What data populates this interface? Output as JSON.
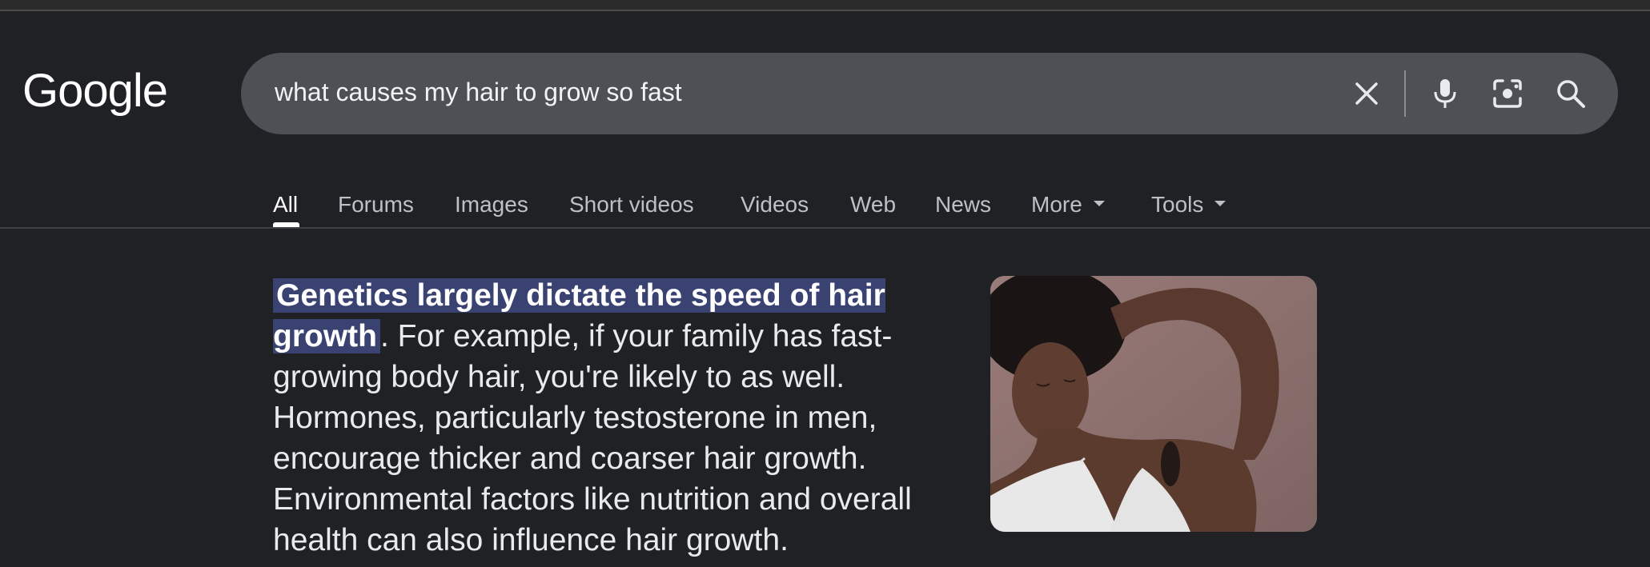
{
  "logo": {
    "text": "Google"
  },
  "search": {
    "query": "what causes my hair to grow so fast"
  },
  "search_icons": [
    "close-icon",
    "microphone-icon",
    "camera-lens-icon",
    "search-icon"
  ],
  "tabs": [
    {
      "label": "All",
      "active": true
    },
    {
      "label": "Forums"
    },
    {
      "label": "Images"
    },
    {
      "label": "Short videos"
    },
    {
      "label": "Videos"
    },
    {
      "label": "Web"
    },
    {
      "label": "News"
    },
    {
      "label": "More",
      "dropdown": true
    },
    {
      "label": "Tools",
      "dropdown": true
    }
  ],
  "snippet": {
    "highlight": "Genetics largely dictate the speed of hair growth",
    "rest": ". For example, if your family has fast-growing body hair, you're likely to as well. Hormones, particularly testosterone in men, encourage thicker and coarser hair growth. Environmental factors like nutrition and overall health can also influence hair growth."
  },
  "colors": {
    "background": "#202124",
    "searchbox": "#4d5156",
    "highlight": "#394270",
    "text": "#e8eaed",
    "tab_inactive": "#bdc1c6"
  }
}
